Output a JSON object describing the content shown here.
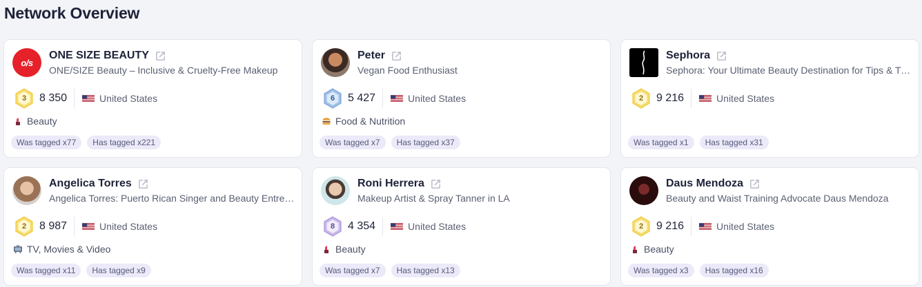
{
  "page": {
    "title": "Network Overview"
  },
  "cards": [
    {
      "name": "ONE SIZE BEAUTY",
      "description": "ONE/SIZE Beauty – Inclusive & Cruelty-Free Makeup",
      "avatar_text": "o/s",
      "level": "3",
      "score": "8 350",
      "country": "United States",
      "category": "Beauty",
      "category_icon": "lipstick-icon",
      "was_tagged": "Was tagged x77",
      "has_tagged": "Has tagged x221"
    },
    {
      "name": "Peter",
      "description": "Vegan Food Enthusiast",
      "level": "6",
      "score": "5 427",
      "country": "United States",
      "category": "Food & Nutrition",
      "category_icon": "burger-icon",
      "was_tagged": "Was tagged x7",
      "has_tagged": "Has tagged x37"
    },
    {
      "name": "Sephora",
      "description": "Sephora: Your Ultimate Beauty Destination for Tips & Trends",
      "level": "2",
      "score": "9 216",
      "country": "United States",
      "category": "",
      "was_tagged": "Was tagged x1",
      "has_tagged": "Has tagged x31"
    },
    {
      "name": "Angelica Torres",
      "description": "Angelica Torres: Puerto Rican Singer and Beauty Entrepreneur",
      "level": "2",
      "score": "8 987",
      "country": "United States",
      "category": "TV, Movies & Video",
      "category_icon": "tv-icon",
      "was_tagged": "Was tagged x11",
      "has_tagged": "Has tagged x9"
    },
    {
      "name": "Roni Herrera",
      "description": "Makeup Artist & Spray Tanner in LA",
      "level": "8",
      "score": "4 354",
      "country": "United States",
      "category": "Beauty",
      "category_icon": "lipstick-icon",
      "was_tagged": "Was tagged x7",
      "has_tagged": "Has tagged x13"
    },
    {
      "name": "Daus Mendoza",
      "description": "Beauty and Waist Training Advocate Daus Mendoza",
      "level": "2",
      "score": "9 216",
      "country": "United States",
      "category": "Beauty",
      "category_icon": "lipstick-icon",
      "was_tagged": "Was tagged x3",
      "has_tagged": "Has tagged x16"
    }
  ],
  "colors": {
    "gold_badge": "#f3d35a",
    "blue_badge": "#8fb5e0",
    "silver_badge": "#c9bce8",
    "tag_bg": "#eceaf9",
    "brand_red": "#e52129"
  }
}
